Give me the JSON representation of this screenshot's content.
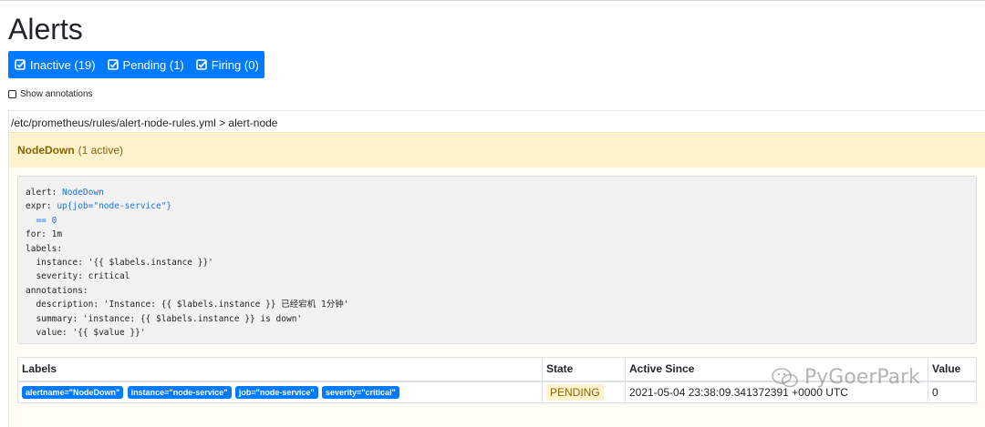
{
  "page": {
    "title": "Alerts"
  },
  "filters": [
    {
      "label": "Inactive (19)"
    },
    {
      "label": "Pending (1)"
    },
    {
      "label": "Firing (0)"
    }
  ],
  "show_annotations": {
    "label": "Show annotations",
    "checked": false
  },
  "group": {
    "path": "/etc/prometheus/rules/alert-node-rules.yml > alert-node",
    "rule": {
      "name": "NodeDown",
      "active_text": "(1 active)",
      "definition": {
        "l1_key": "alert: ",
        "l1_val": "NodeDown",
        "l2_key": "expr: ",
        "l2_val": "up{job=\"node-service\"}",
        "l3_val": "  == 0",
        "l4": "for: 1m",
        "l5": "labels:",
        "l6": "  instance: '{{ $labels.instance }}'",
        "l7": "  severity: critical",
        "l8": "annotations:",
        "l9": "  description: 'Instance: {{ $labels.instance }} 已经宕机 1分钟'",
        "l10": "  summary: 'instance: {{ $labels.instance }} is down'",
        "l11": "  value: '{{ $value }}'"
      }
    },
    "table": {
      "headers": {
        "labels": "Labels",
        "state": "State",
        "active_since": "Active Since",
        "value": "Value"
      },
      "row": {
        "labels": [
          "alertname=\"NodeDown\"",
          "instance=\"node-service\"",
          "job=\"node-service\"",
          "severity=\"critical\""
        ],
        "state": "PENDING",
        "active_since": "2021-05-04 23:38:09.341372391 +0000 UTC",
        "value": "0"
      }
    }
  },
  "watermark": {
    "text": "PyGoerPark"
  },
  "colors": {
    "primary": "#007bff",
    "warning_bg": "#fff3cd",
    "warning_text": "#856404"
  }
}
